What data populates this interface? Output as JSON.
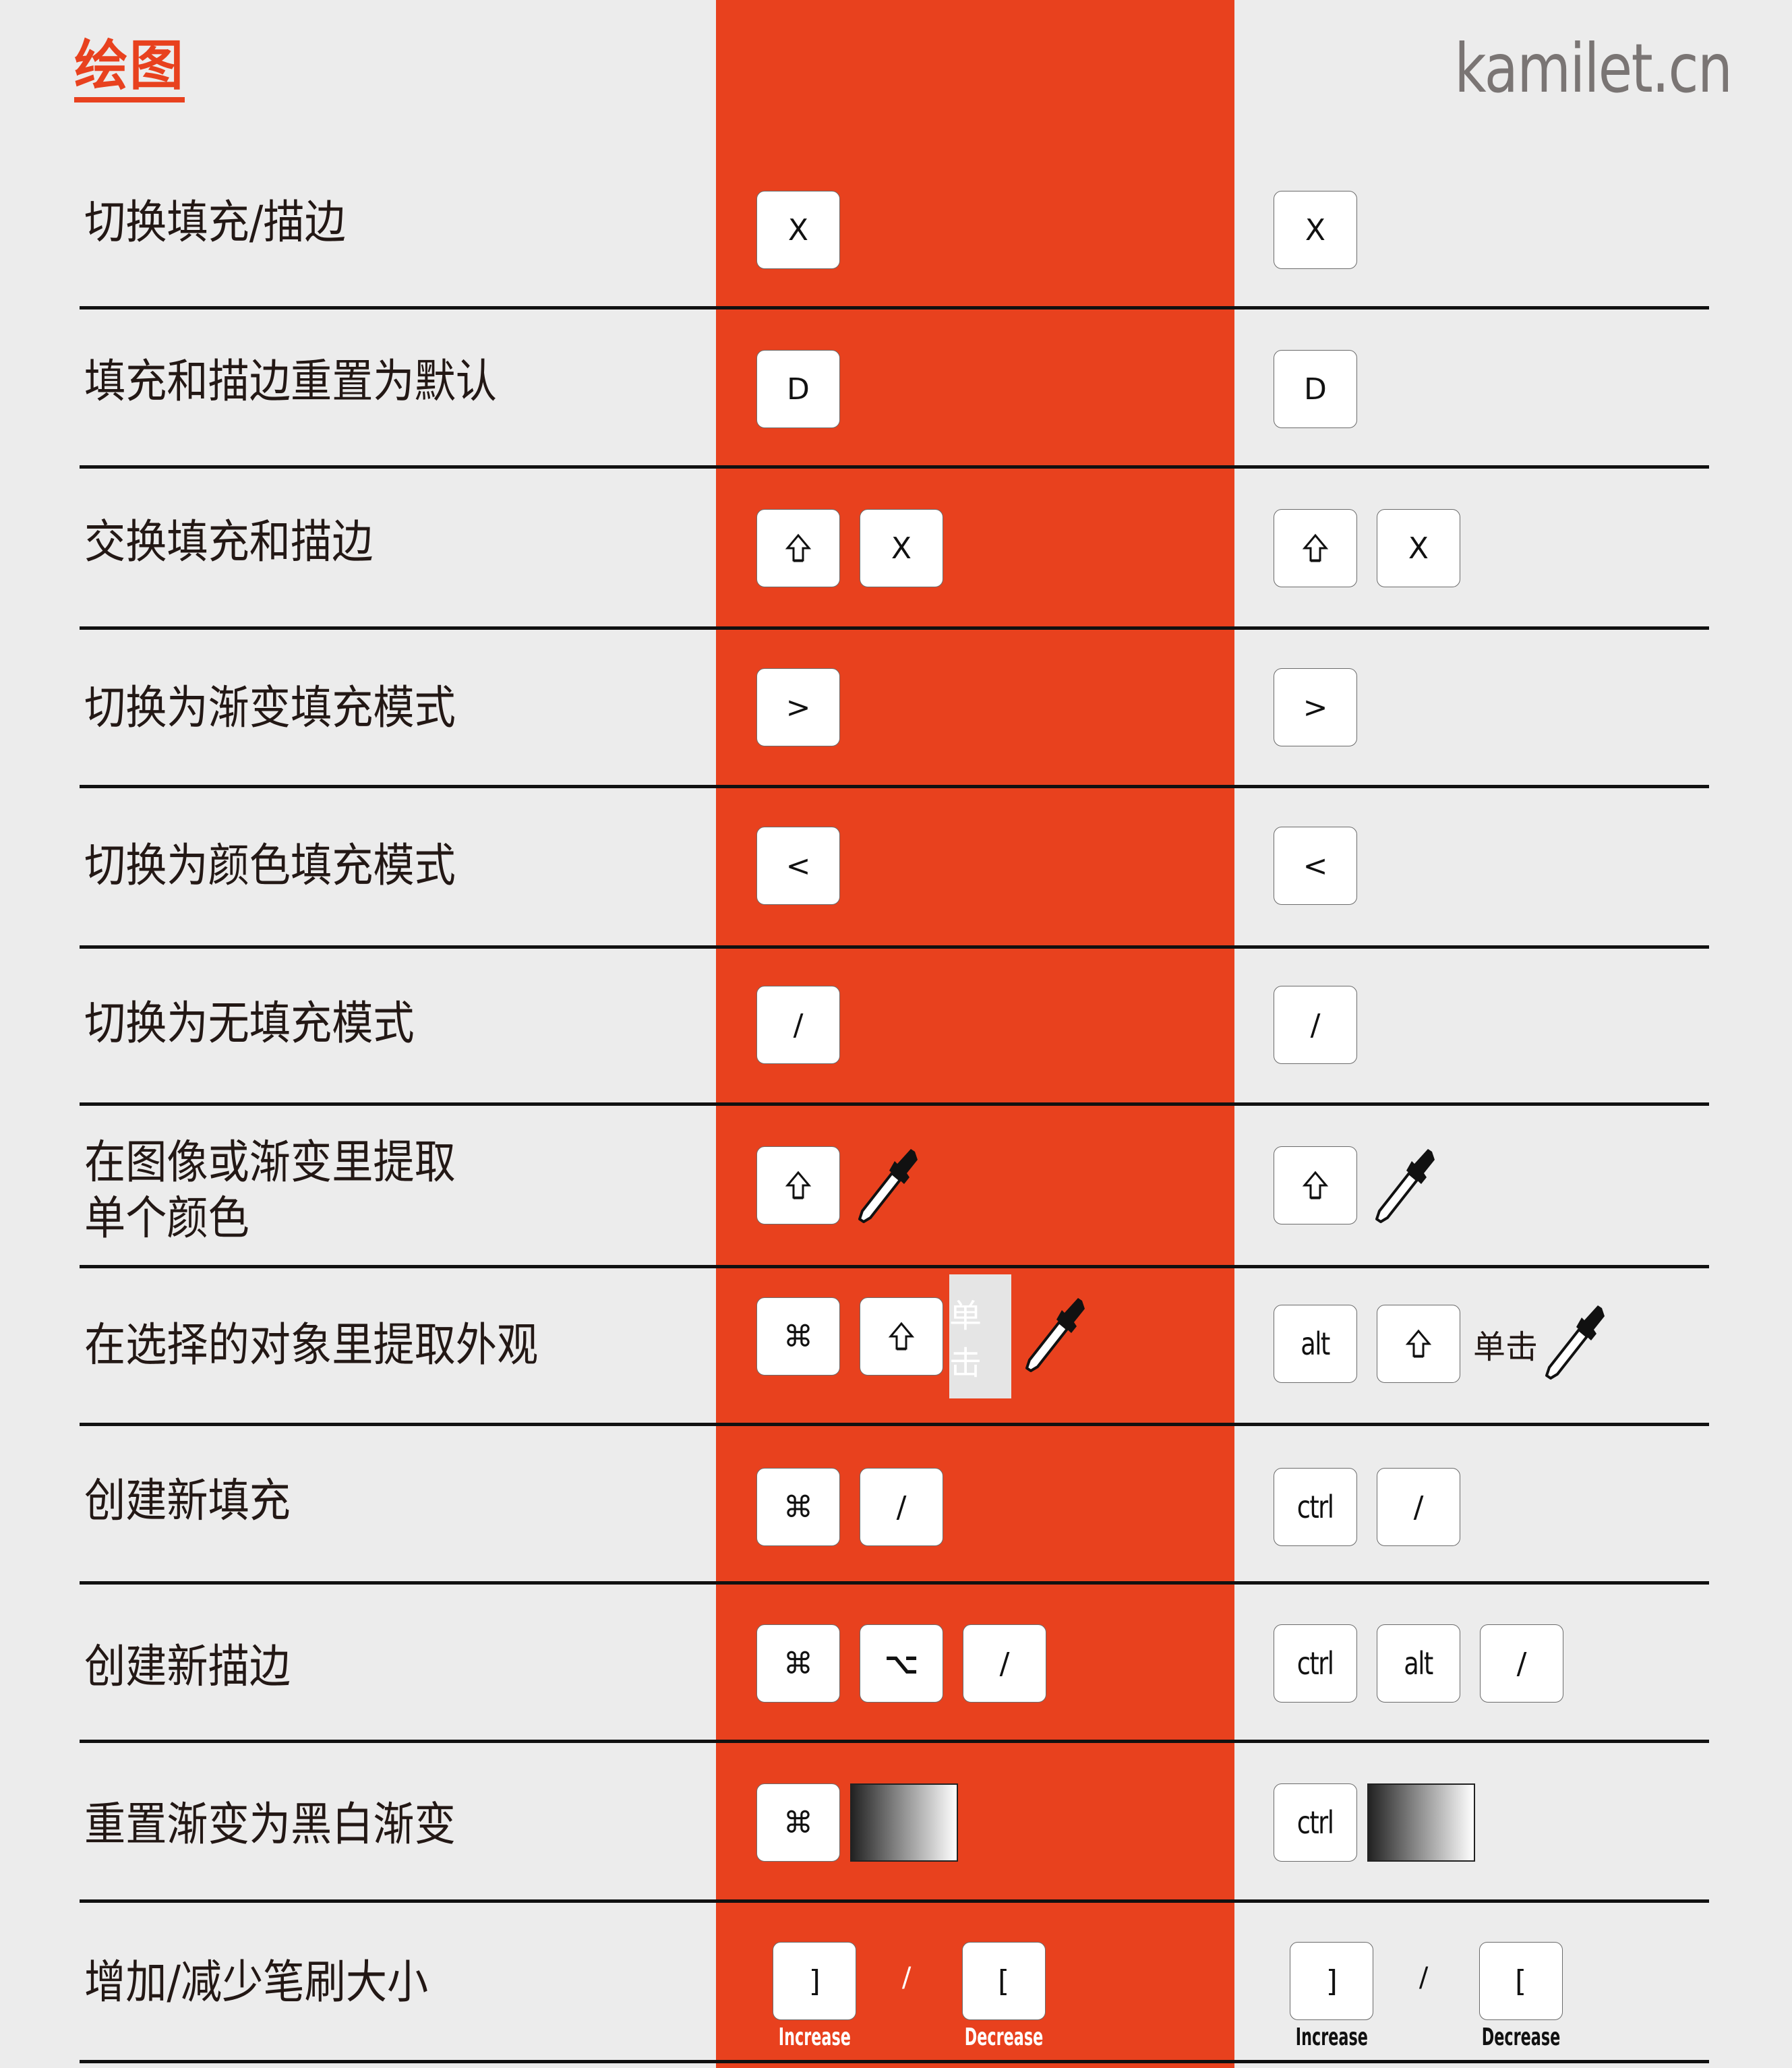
{
  "header": {
    "title": "绘图",
    "brand": "kamilet.cn"
  },
  "colors": {
    "accent": "#e8411e",
    "background": "#ececec",
    "text": "#231815",
    "brand_text": "#7a7574"
  },
  "rows": [
    {
      "label": "切换填充/描边",
      "mac": [
        "X"
      ],
      "win": [
        "X"
      ]
    },
    {
      "label": "填充和描边重置为默认",
      "mac": [
        "D"
      ],
      "win": [
        "D"
      ]
    },
    {
      "label": "交换填充和描边",
      "mac": [
        "shift-icon",
        "X"
      ],
      "win": [
        "shift-icon",
        "X"
      ]
    },
    {
      "label": "切换为渐变填充模式",
      "mac": [
        ">"
      ],
      "win": [
        ">"
      ]
    },
    {
      "label": "切换为颜色填充模式",
      "mac": [
        "<"
      ],
      "win": [
        "<"
      ]
    },
    {
      "label": "切换为无填充模式",
      "mac": [
        "/"
      ],
      "win": [
        "/"
      ]
    },
    {
      "label_line1": "在图像或渐变里提取",
      "label_line2": "单个颜色",
      "mac": [
        "shift-icon",
        "eyedropper-icon"
      ],
      "win": [
        "shift-icon",
        "eyedropper-icon"
      ]
    },
    {
      "label": "在选择的对象里提取外观",
      "mac": [
        "⌘",
        "shift-icon",
        "单击",
        "eyedropper-icon"
      ],
      "win": [
        "alt",
        "shift-icon",
        "单击",
        "eyedropper-icon"
      ],
      "click": "单击"
    },
    {
      "label": "创建新填充",
      "mac": [
        "⌘",
        "/"
      ],
      "win": [
        "ctrl",
        "/"
      ]
    },
    {
      "label": "创建新描边",
      "mac": [
        "⌘",
        "⌥",
        "/"
      ],
      "win": [
        "ctrl",
        "alt",
        "/"
      ]
    },
    {
      "label": "重置渐变为黑白渐变",
      "mac": [
        "⌘",
        "gradient-swatch"
      ],
      "win": [
        "ctrl",
        "gradient-swatch"
      ]
    },
    {
      "label": "增加/减少笔刷大小",
      "mac": [
        "]",
        "/",
        "["
      ],
      "win": [
        "]",
        "/",
        "["
      ],
      "increase": "Increase",
      "decrease": "Decrease"
    }
  ],
  "keys": {
    "X": "X",
    "D": "D",
    "gt": ">",
    "lt": "<",
    "slash": "/",
    "cmd": "⌘",
    "opt": "⌥",
    "alt": "alt",
    "ctrl": "ctrl",
    "rbracket": "]",
    "lbracket": "[",
    "shift": "⇧"
  }
}
